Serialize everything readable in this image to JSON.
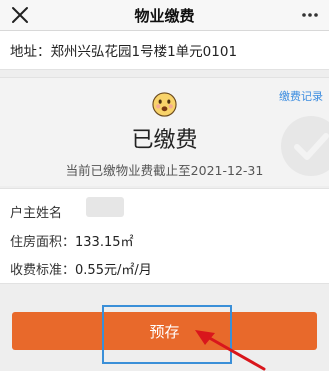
{
  "nav": {
    "title": "物业缴费",
    "close_icon": "close-icon",
    "more_icon": "more-icon"
  },
  "address": {
    "text": "地址：郑州兴弘花园1号楼1单元0101"
  },
  "status": {
    "records_link": "缴费记录",
    "icon": "smiley-icon",
    "title": "已缴费",
    "subtitle": "当前已缴物业费截止至2021-12-31"
  },
  "info": {
    "owner_label": "户主姓名",
    "area_label": "住房面积：",
    "area_value": "133.15㎡",
    "fee_label": "收费标准：",
    "fee_value": "0.55元/㎡/月"
  },
  "actions": {
    "prestore_label": "预存"
  },
  "colors": {
    "accent_orange": "#e8692b",
    "link_blue": "#3d8de0",
    "highlight_blue": "#3a8fd8",
    "annotation_red": "#d9161c"
  }
}
